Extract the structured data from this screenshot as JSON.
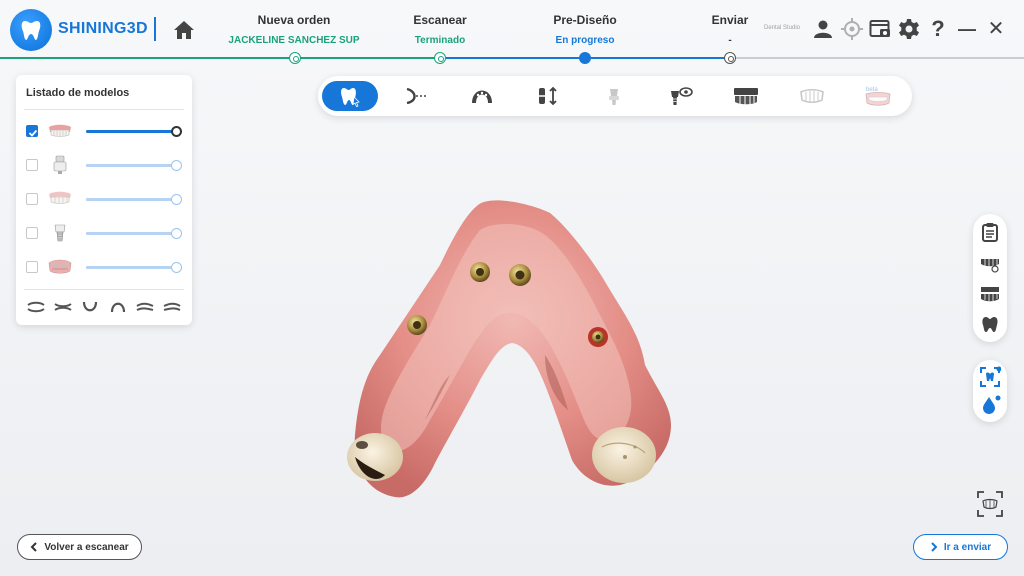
{
  "header": {
    "brand": "SHINING3D",
    "steps": [
      {
        "title": "Nueva orden",
        "status": "JACKELINE SANCHEZ SUP",
        "status_color": "#1aa37a"
      },
      {
        "title": "Escanear",
        "status": "Terminado",
        "status_color": "#1aa37a"
      },
      {
        "title": "Pre-Diseño",
        "status": "En progreso",
        "status_color": "#1677d8"
      },
      {
        "title": "Enviar",
        "status": "-",
        "status_color": "#333333"
      }
    ],
    "studio_label": "Dental Studio",
    "help_glyph": "?",
    "minimize_glyph": "—",
    "close_glyph": "✕"
  },
  "model_list": {
    "title": "Listado de modelos",
    "items": [
      {
        "thumb": "full-arch-teeth-icon",
        "checked": true,
        "opacity": 1.0
      },
      {
        "thumb": "scan-body-icon",
        "checked": false,
        "opacity": 1.0
      },
      {
        "thumb": "dentition-icon",
        "checked": false,
        "opacity": 1.0
      },
      {
        "thumb": "implant-icon",
        "checked": false,
        "opacity": 1.0
      },
      {
        "thumb": "arch-textured-icon",
        "checked": false,
        "opacity": 1.0
      }
    ]
  },
  "toolbar": {
    "tools": [
      "tooth-selection-icon",
      "trim-cut-icon",
      "arch-icon",
      "tooth-adjust-icon",
      "abutment-icon",
      "implant-view-icon",
      "dentition-bar-icon",
      "dentition-outline-icon",
      "smile-beta-icon"
    ],
    "active_index": 0,
    "beta_label": "beta"
  },
  "footer": {
    "back_label": "Volver a escanear",
    "next_label": "Ir a enviar"
  },
  "colors": {
    "accent": "#1677d8",
    "done": "#1aa37a"
  }
}
